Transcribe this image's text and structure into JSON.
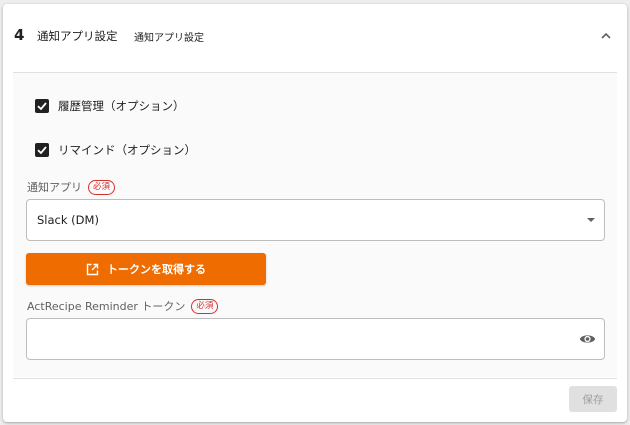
{
  "header": {
    "step_number": "4",
    "title": "通知アプリ設定",
    "subtitle": "通知アプリ設定",
    "collapse_icon": "chevron-up-icon"
  },
  "options": [
    {
      "label": "履歴管理（オプション）",
      "checked": true
    },
    {
      "label": "リマインド（オプション）",
      "checked": true
    }
  ],
  "notify_app": {
    "label": "通知アプリ",
    "required_badge": "必須",
    "selected_value": "Slack (DM)"
  },
  "token_button": {
    "label": "トークンを取得する",
    "icon": "open-in-new-icon",
    "color": "#ef6c00"
  },
  "token_field": {
    "label": "ActRecipe Reminder トークン",
    "required_badge": "必須",
    "value": "",
    "icon": "eye-icon"
  },
  "footer": {
    "save_label": "保存",
    "save_enabled": false
  }
}
